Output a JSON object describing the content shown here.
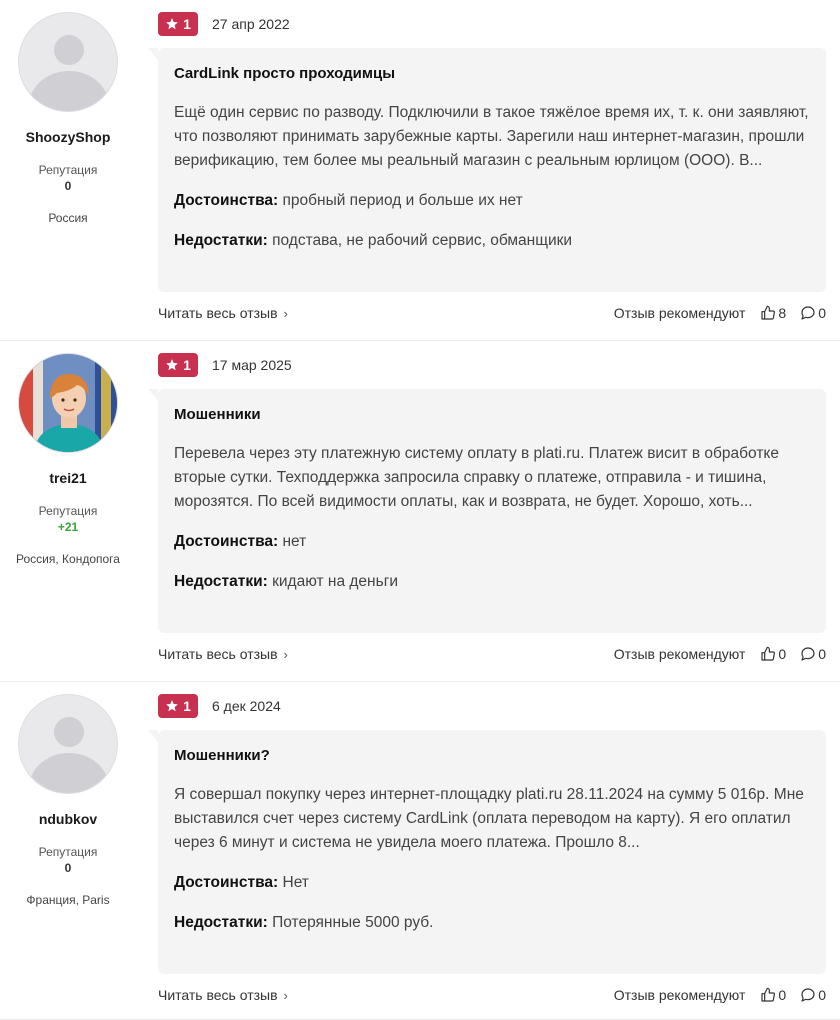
{
  "labels": {
    "reputation": "Репутация",
    "read_more": "Читать весь отзыв",
    "read_more_chevron": "›",
    "recommend": "Отзыв рекомендуют",
    "pros": "Достоинства:",
    "cons": "Недостатки:"
  },
  "colors": {
    "badge": "#c8304f",
    "reputation_positive": "#3aa23a"
  },
  "reviews": [
    {
      "author": "ShoozyShop",
      "avatar": "avatar-placeholder-icon",
      "reputation": "0",
      "location": "Россия",
      "rating": "1",
      "date": "27 апр 2022",
      "title": "CardLink просто проходимцы",
      "text": "Ещё один сервис по разводу. Подключили в такое тяжёлое время их, т. к. они заявляют, что позволяют принимать зарубежные карты. Зарегили наш интернет-магазин, прошли верификацию, тем более мы реальный магазин с реальным юрлицом (ООО). В...",
      "pros": "пробный период и больше их нет",
      "cons": "подстава, не рабочий сервис, обманщики",
      "likes": "8",
      "comments": "0"
    },
    {
      "author": "trei21",
      "avatar": "user-photo",
      "reputation": "+21",
      "location": "Россия, Кондопога",
      "rating": "1",
      "date": "17 мар 2025",
      "title": "Мошенники",
      "text": "Перевела через эту платежную систему оплату в plati.ru. Платеж висит в обработке вторые сутки. Техподдержка запросила справку о платеже, отправила - и тишина, морозятся. По всей видимости оплаты, как и возврата, не будет. Хорошо, хоть...",
      "pros": "нет",
      "cons": "кидают на деньги",
      "likes": "0",
      "comments": "0"
    },
    {
      "author": "ndubkov",
      "avatar": "avatar-placeholder-icon",
      "reputation": "0",
      "location": "Франция, Paris",
      "rating": "1",
      "date": "6 дек 2024",
      "title": "Мошенники?",
      "text": "Я совершал покупку через интернет-площадку plati.ru 28.11.2024 на сумму 5 016р. Мне выставился счет через систему CardLink (оплата переводом на карту). Я его оплатил через 6 минут и система не увидела моего платежа. Прошло 8...",
      "pros": "Нет",
      "cons": "Потерянные 5000 руб.",
      "likes": "0",
      "comments": "0"
    }
  ]
}
